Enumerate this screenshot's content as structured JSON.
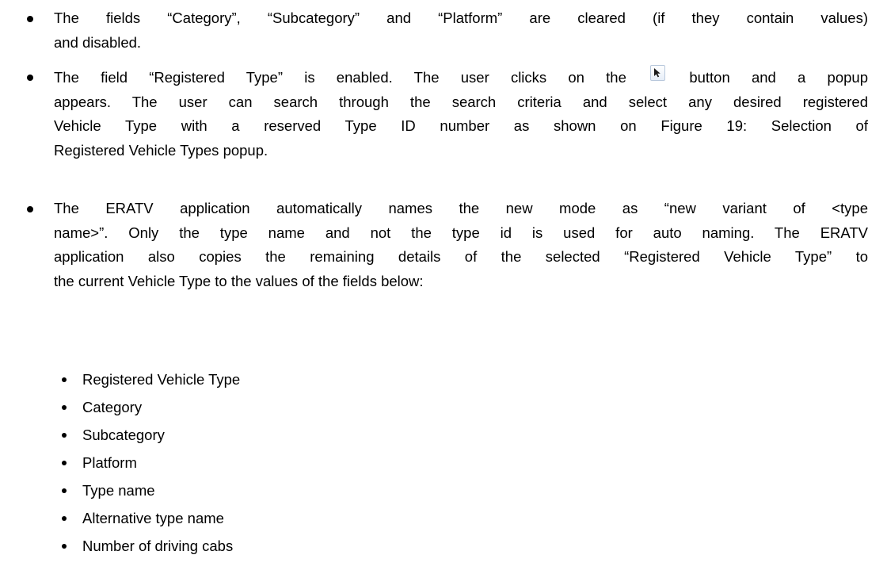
{
  "bullets": [
    {
      "lines": [
        "The fields “Category”, “Subcategory” and “Platform” are cleared (if they contain values)",
        "and disabled."
      ]
    },
    {
      "line1_before_icon": "The field “Registered Type” is enabled. The user clicks on the",
      "line1_after_icon": "button and a popup",
      "lines": [
        "appears. The user can search through the search criteria and select any desired registered",
        "Vehicle Type with a reserved Type ID number as shown on Figure 19: Selection of",
        "Registered Vehicle Types popup."
      ],
      "icon": "select-pointer-icon"
    },
    {
      "lines": [
        "The ERATV application automatically names the new mode as “new variant of <type",
        "name>”. Only the type name and not the type id is used for auto naming. The ERATV",
        "application also copies the remaining details of the selected “Registered Vehicle Type” to",
        "the current Vehicle Type to the values of the fields below:"
      ]
    }
  ],
  "fields": [
    "Registered Vehicle Type",
    "Category",
    "Subcategory",
    "Platform",
    "Type name",
    "Alternative type name",
    "Number of driving cabs"
  ]
}
